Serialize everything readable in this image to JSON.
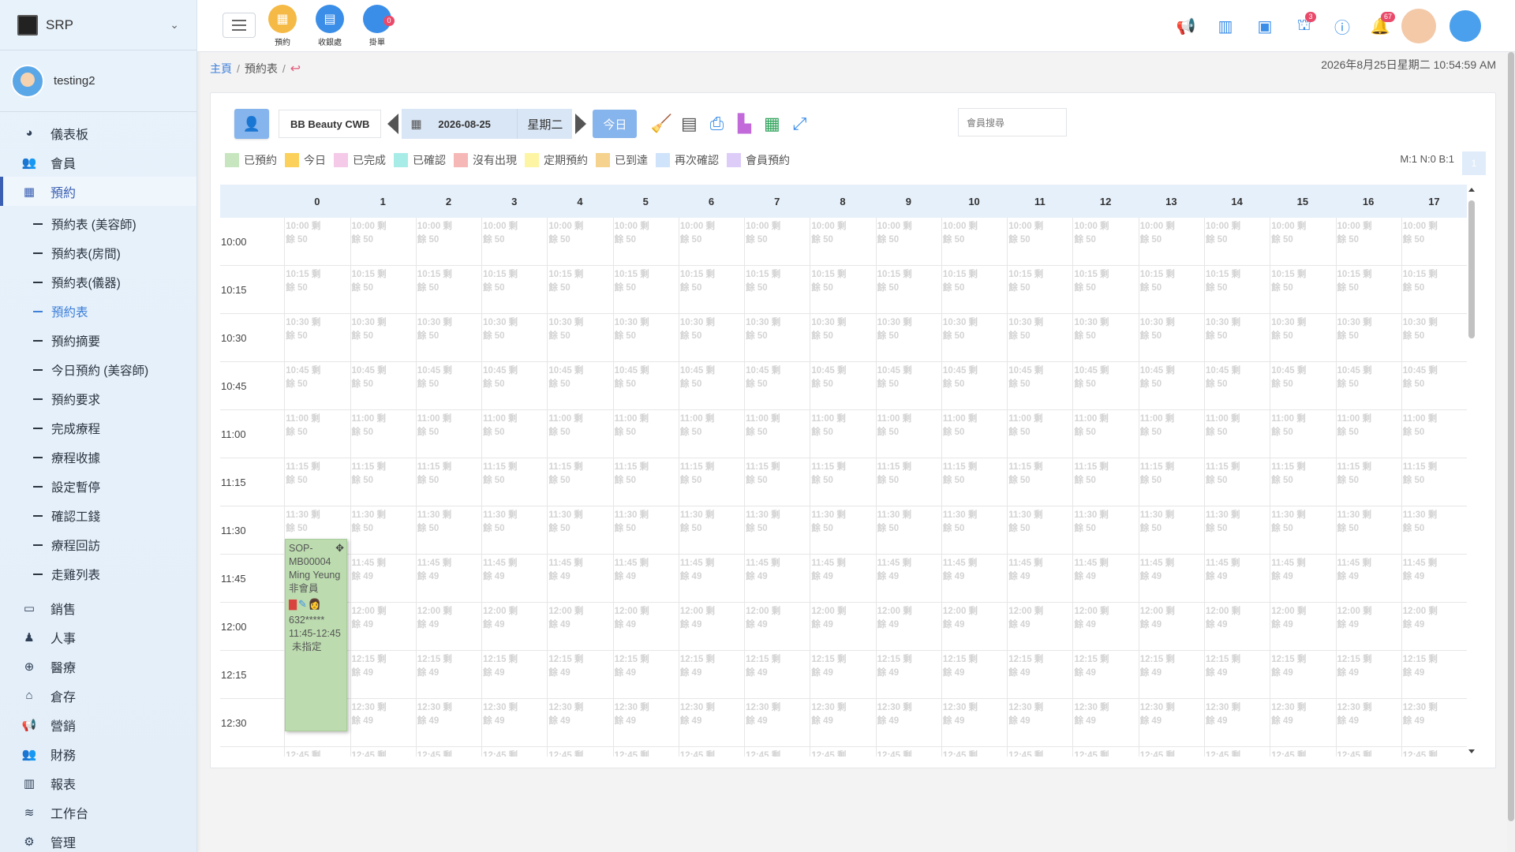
{
  "brand": {
    "name": "SRP"
  },
  "user": {
    "name": "testing2"
  },
  "sidebar": {
    "items": [
      {
        "label": "儀表板",
        "icon": "dashboard-icon"
      },
      {
        "label": "會員",
        "icon": "users-icon"
      },
      {
        "label": "預約",
        "icon": "calendar-icon"
      }
    ],
    "sub_items": [
      "預約表 (美容師)",
      "預約表(房間)",
      "預約表(儀器)",
      "預約表",
      "預約摘要",
      "今日預約 (美容師)",
      "預約要求",
      "完成療程",
      "療程收據",
      "設定暫停",
      "確認工錢",
      "療程回訪",
      "走雞列表"
    ],
    "items_after": [
      {
        "label": "銷售",
        "icon": "sales-icon"
      },
      {
        "label": "人事",
        "icon": "person-icon"
      },
      {
        "label": "醫療",
        "icon": "medical-icon"
      },
      {
        "label": "倉存",
        "icon": "warehouse-icon"
      },
      {
        "label": "營銷",
        "icon": "megaphone-icon"
      },
      {
        "label": "財務",
        "icon": "finance-icon"
      },
      {
        "label": "報表",
        "icon": "report-icon"
      },
      {
        "label": "工作台",
        "icon": "layers-icon"
      },
      {
        "label": "管理",
        "icon": "gear-icon"
      }
    ]
  },
  "topbar": {
    "quick": [
      {
        "label": "預約",
        "color": "#f5b945"
      },
      {
        "label": "收銀處",
        "color": "#3b8ee8"
      },
      {
        "label": "掛單",
        "color": "#3b8ee8",
        "badge": "0"
      }
    ],
    "badges": {
      "members": "3",
      "notifications": "67"
    }
  },
  "breadcrumb": {
    "home": "主頁",
    "current": "預約表"
  },
  "datetime": "2026年8月25日星期二 10:54:59 AM",
  "toolbar": {
    "shop": "BB Beauty CWB",
    "date": "2026-08-25",
    "weekday": "星期二",
    "today": "今日",
    "search_placeholder": "會員搜尋"
  },
  "legend": [
    {
      "label": "已預約",
      "color": "#c7e6bf"
    },
    {
      "label": "今日",
      "color": "#fbd15b"
    },
    {
      "label": "已完成",
      "color": "#f5c9e8"
    },
    {
      "label": "已確認",
      "color": "#a8ece8"
    },
    {
      "label": "沒有出現",
      "color": "#f6b7b7"
    },
    {
      "label": "定期預約",
      "color": "#fdf5a3"
    },
    {
      "label": "已到達",
      "color": "#f5d28d"
    },
    {
      "label": "再次確認",
      "color": "#cfe3fb"
    },
    {
      "label": "會員預約",
      "color": "#dcccf7"
    }
  ],
  "stats": "M:1 N:0 B:1",
  "page_button": "1",
  "columns": [
    "0",
    "1",
    "2",
    "3",
    "4",
    "5",
    "6",
    "7",
    "8",
    "9",
    "10",
    "11",
    "12",
    "13",
    "14",
    "15",
    "16",
    "17"
  ],
  "rows": [
    {
      "time": "10:00",
      "slot": "10:00 剩",
      "remain": "餘 50"
    },
    {
      "time": "10:15",
      "slot": "10:15 剩",
      "remain": "餘 50"
    },
    {
      "time": "10:30",
      "slot": "10:30 剩",
      "remain": "餘 50"
    },
    {
      "time": "10:45",
      "slot": "10:45 剩",
      "remain": "餘 50"
    },
    {
      "time": "11:00",
      "slot": "11:00 剩",
      "remain": "餘 50"
    },
    {
      "time": "11:15",
      "slot": "11:15 剩",
      "remain": "餘 50"
    },
    {
      "time": "11:30",
      "slot": "11:30 剩",
      "remain": "餘 50"
    },
    {
      "time": "11:45",
      "slot": "11:45 剩",
      "remain": "餘 49"
    },
    {
      "time": "12:00",
      "slot": "12:00 剩",
      "remain": "餘 49"
    },
    {
      "time": "12:15",
      "slot": "12:15 剩",
      "remain": "餘 49"
    },
    {
      "time": "12:30",
      "slot": "12:30 剩",
      "remain": "餘 49"
    },
    {
      "time": "",
      "slot": "12:45 剩",
      "remain": "餘 49"
    }
  ],
  "appointment": {
    "code": "SOP-MB00004",
    "name": "Ming Yeung",
    "type": "非會員",
    "phone": "632*****",
    "time": "11:45-12:45",
    "staff": "未指定"
  }
}
